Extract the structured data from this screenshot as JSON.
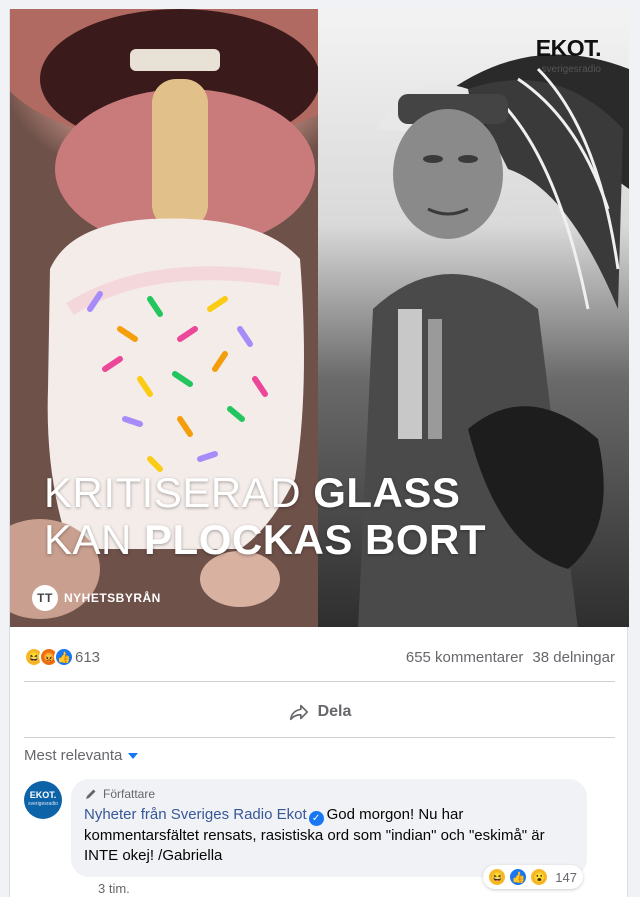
{
  "post": {
    "image": {
      "headline_light_1": "KRITISERAD",
      "headline_bold_1": "GLASS",
      "headline_light_2": "KAN",
      "headline_bold_2": "PLOCKAS BORT",
      "source_badge": "NYHETSBYRÅN",
      "source_icon_text": "TT",
      "logo": "EKOT.",
      "logo_sub": "sverigesradio"
    },
    "stats": {
      "reaction_count": "613",
      "comments": "655 kommentarer",
      "shares": "38 delningar"
    },
    "actions": {
      "share_label": "Dela"
    },
    "comments": {
      "sort_label": "Mest relevanta",
      "items": [
        {
          "avatar_text": "EKOT.",
          "avatar_sub": "sverigesradio",
          "badge": "Författare",
          "author": "Nyheter från Sveriges Radio Ekot",
          "text": "God morgon! Nu har kommentarsfältet rensats, rasistiska ord som \"indian\" och \"eskimå\" är INTE okej! /Gabriella",
          "reaction_count": "147",
          "time": "3 tim."
        }
      ]
    }
  },
  "colors": {
    "link": "#385898",
    "accent": "#1877f2",
    "muted": "#65676b"
  },
  "icons": [
    "haha-reaction-icon",
    "angry-reaction-icon",
    "like-reaction-icon",
    "wow-reaction-icon",
    "share-arrow-icon",
    "sort-caret-icon",
    "verified-check-icon",
    "pencil-icon"
  ]
}
